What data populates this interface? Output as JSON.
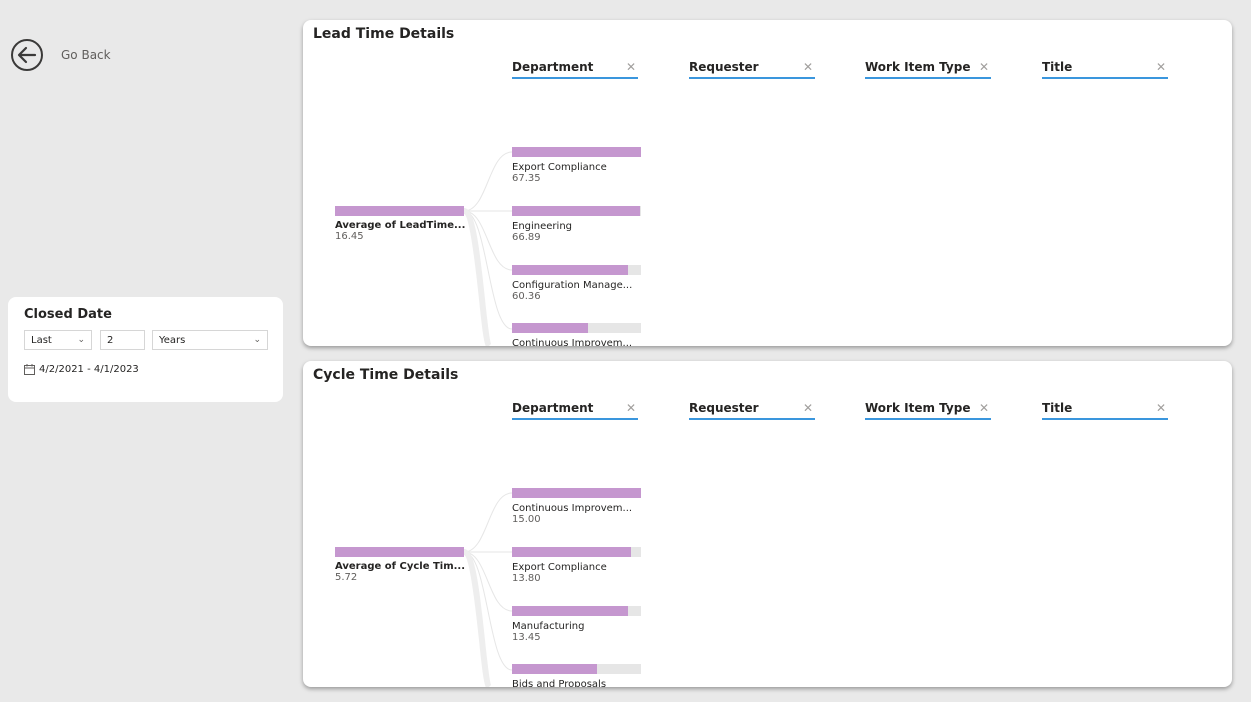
{
  "nav": {
    "go_back_label": "Go Back"
  },
  "slicer": {
    "title": "Closed Date",
    "relative": "Last",
    "count": "2",
    "unit": "Years",
    "range": "4/2/2021 - 4/1/2023"
  },
  "lead_card": {
    "title": "Lead Time Details",
    "levels": [
      {
        "label": "Department"
      },
      {
        "label": "Requester"
      },
      {
        "label": "Work Item Type"
      },
      {
        "label": "Title"
      }
    ],
    "root": {
      "label": "Average of LeadTime...",
      "value": "16.45"
    },
    "nodes": [
      {
        "label": "Export Compliance",
        "value": "67.35",
        "fill": 1.0
      },
      {
        "label": "Engineering",
        "value": "66.89",
        "fill": 0.993
      },
      {
        "label": "Configuration Manage...",
        "value": "60.36",
        "fill": 0.896
      },
      {
        "label": "Continuous Improvem...",
        "value": "",
        "fill": 0.59
      }
    ]
  },
  "cycle_card": {
    "title": "Cycle Time Details",
    "levels": [
      {
        "label": "Department"
      },
      {
        "label": "Requester"
      },
      {
        "label": "Work Item Type"
      },
      {
        "label": "Title"
      }
    ],
    "root": {
      "label": "Average of Cycle Tim...",
      "value": "5.72"
    },
    "nodes": [
      {
        "label": "Continuous Improvem...",
        "value": "15.00",
        "fill": 1.0
      },
      {
        "label": "Export Compliance",
        "value": "13.80",
        "fill": 0.92
      },
      {
        "label": "Manufacturing",
        "value": "13.45",
        "fill": 0.897
      },
      {
        "label": "Bids and Proposals",
        "value": "",
        "fill": 0.66
      }
    ]
  },
  "colors": {
    "bar": "#c597cf",
    "track": "#e6e6e6",
    "accent": "#3a96dd"
  }
}
